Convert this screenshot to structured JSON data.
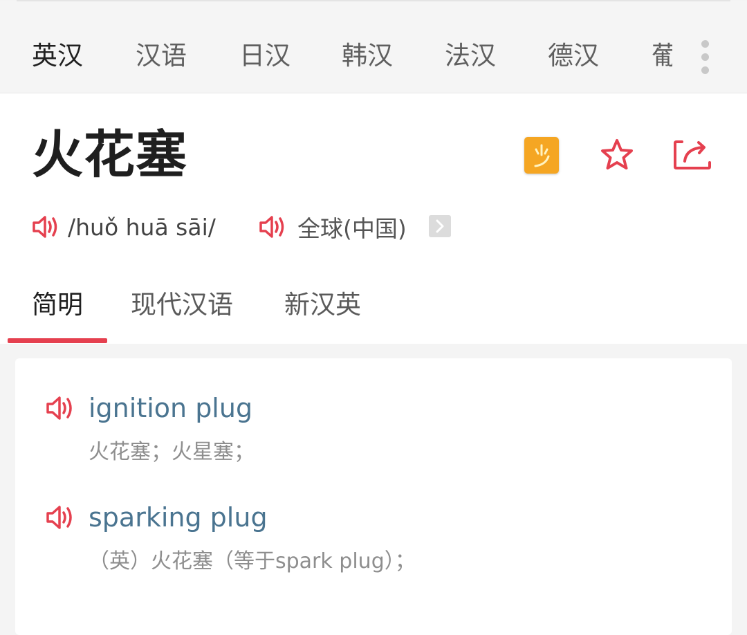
{
  "lang_tabs": [
    {
      "label": "英汉",
      "active": true
    },
    {
      "label": "汉语",
      "active": false
    },
    {
      "label": "日汉",
      "active": false
    },
    {
      "label": "韩汉",
      "active": false
    },
    {
      "label": "法汉",
      "active": false
    },
    {
      "label": "德汉",
      "active": false
    },
    {
      "label": "葡",
      "active": false
    }
  ],
  "headword": "火花塞",
  "pinyin": "/huǒ huā sāi/",
  "region": "全球(中国)",
  "dict_tabs": [
    {
      "label": "简明",
      "active": true
    },
    {
      "label": "现代汉语",
      "active": false
    },
    {
      "label": "新汉英",
      "active": false
    }
  ],
  "entries": [
    {
      "word": "ignition plug",
      "definition": "火花塞；火星塞；"
    },
    {
      "word": "sparking plug",
      "definition": "（英）火花塞（等于spark plug）；"
    }
  ],
  "icons": {
    "badge": "dictionary-badge-icon",
    "favorite": "star-outline-icon",
    "share": "share-icon",
    "speaker": "speaker-icon",
    "more": "more-vertical-icon"
  },
  "colors": {
    "accent": "#e5404f",
    "badge": "#f5a623",
    "entry_word": "#4a7490",
    "definition": "#8e8e8e"
  }
}
